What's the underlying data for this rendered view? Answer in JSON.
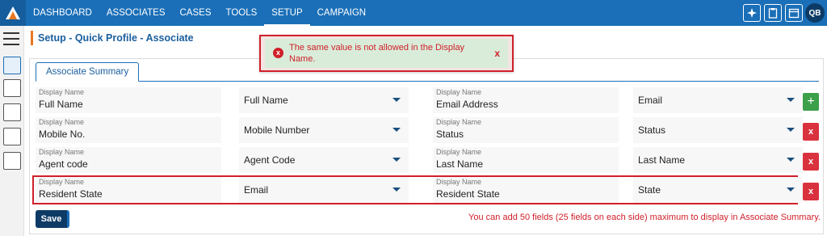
{
  "nav": {
    "items": [
      "DASHBOARD",
      "ASSOCIATES",
      "CASES",
      "TOOLS",
      "SETUP",
      "CAMPAIGN"
    ],
    "active": "SETUP",
    "avatar_initials": "QB"
  },
  "page": {
    "title": "Setup - Quick Profile - Associate"
  },
  "alert": {
    "icon": "x-circle-icon",
    "message": "The same value is not allowed in the Display Name.",
    "close": "x"
  },
  "tabs": {
    "active_label": "Associate Summary"
  },
  "fields": {
    "caption": "Display Name",
    "rows": [
      {
        "left_display": "Full Name",
        "left_select": "Full Name",
        "right_display": "Email Address",
        "right_select": "Email",
        "action": "+"
      },
      {
        "left_display": "Mobile No.",
        "left_select": "Mobile Number",
        "right_display": "Status",
        "right_select": "Status",
        "action": "x"
      },
      {
        "left_display": "Agent code",
        "left_select": "Agent Code",
        "right_display": "Last Name",
        "right_select": "Last Name",
        "action": "x"
      },
      {
        "left_display": "Resident State",
        "left_select": "Email",
        "right_display": "Resident State",
        "right_select": "State",
        "action": "x"
      }
    ]
  },
  "footer": {
    "save_label": "Save",
    "note": "You can add 50 fields (25 fields on each side) maximum to display in Associate Summary."
  },
  "colors": {
    "nav_bg": "#1a6fb8",
    "error": "#d0202a",
    "add_green": "#3c9f4a",
    "delete_red": "#d9323e",
    "save_navy": "#0d3b66"
  }
}
